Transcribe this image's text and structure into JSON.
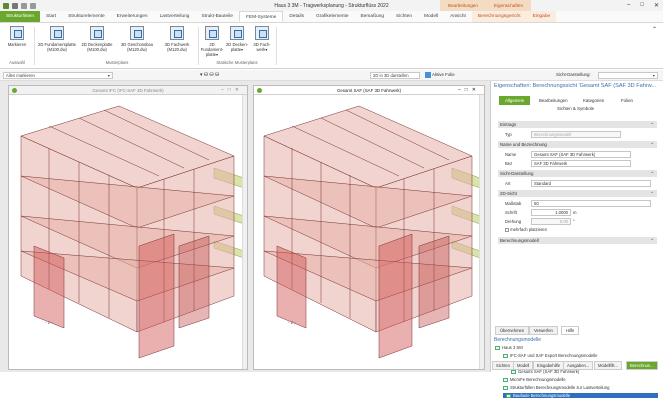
{
  "window": {
    "title": "Haus 3 3M - Tragwerksplanung - Strukturflüss 2022",
    "context_groups": [
      "Bearbeitungen",
      "Eigenschaften"
    ],
    "controls": [
      "–",
      "□",
      "✕"
    ]
  },
  "tabs": [
    "Strukturlisten",
    "Start",
    "Strukturelemente",
    "Erweiterungen",
    "Lastverteilung",
    "Strukt-Bauteile",
    "FEM-Systeme",
    "Details",
    "Grafikelemente",
    "Bemaßung",
    "Sichten",
    "Modell",
    "Ansicht",
    "Berechnungsgericht",
    "Eingabe"
  ],
  "ribbon": {
    "buttons": [
      {
        "label": "Markieren"
      },
      {
        "label": "2D Fundamentplatte (M100.dw)"
      },
      {
        "label": "2D Deckenplatte (M100.dw)"
      },
      {
        "label": "3D Geschossbau (M120.dw)"
      },
      {
        "label": "3D Fachwerk (M120.dw)"
      },
      {
        "label": "2D Fundament-platte▾"
      },
      {
        "label": "2D Decken-platte▾"
      },
      {
        "label": "3D Fach-werk▾"
      }
    ],
    "groups": [
      "Auswahl",
      "Musterplans",
      "Statische Musterplans"
    ]
  },
  "toolbar": {
    "filter_value": "Alles markieren",
    "view_button": "2D in 3D darstellen",
    "active_label": "Aktive Folie",
    "sicht_label": "Sicht-Darstellung:"
  },
  "viewports": [
    {
      "title": "Gesamt IFC (IFC-SAF 3D Fahrwerk)",
      "active": false,
      "axis_label": "- z -"
    },
    {
      "title": "Gesamt SAF (SAF 3D Fahrwerk)",
      "active": true,
      "axis_label": "- z -"
    }
  ],
  "panel": {
    "title": "Eigenschaften: Berechnungssicht 'Gesamt SAF (SAF 3D Fahrw...",
    "tabs": [
      "Allgemein",
      "Bearbeitungen",
      "Kategorien",
      "Folien"
    ],
    "subtab": "Sichten & Symbole",
    "sections": {
      "eintrag": "Eintrags",
      "typ_label": "Typ",
      "typ_value": "Berechnungsmodell",
      "name_section": "Name und Bezeichnung",
      "name_label": "Name",
      "name_value": "Gesamt SAF (SAF 3D Fahrwerk)",
      "bez_label": "Bez",
      "bez_value": "SAF 3D Fahrwerk",
      "darst_section": "Sicht-Darstellung",
      "art_label": "Art",
      "art_value": "Standard",
      "sicht_section": "2D-Sicht",
      "mass_label": "Maßstab",
      "mass_value": "50",
      "schrift_label": "Schrift",
      "schrift_value": "1.0000",
      "schrift_unit": "m",
      "drehung_label": "Drehung",
      "drehung_value": "0.00",
      "drehung_unit": "°",
      "check_label": "mehrfach platzieren",
      "berech_section": "Berechnungsmodell"
    },
    "bottom_tabs": [
      "Übernehmen",
      "Verwerfen",
      "Hilfe"
    ],
    "tree_title": "Berechnungsmodelle",
    "tree": [
      {
        "label": "Haus 3 SM",
        "level": 0
      },
      {
        "label": "IFC-SAF und SAF Export Berechnungsmodelle",
        "level": 1
      },
      {
        "label": "Gesamt IFC (IFC-SAF 3D Fahrwerk)",
        "level": 2
      },
      {
        "label": "Gesamt SAF (SAF 3D Fahrwerk)",
        "level": 2
      },
      {
        "label": "MicroFe Berechnungsmodelle",
        "level": 1
      },
      {
        "label": "Strukturfüllen Berechnungsmodelle zur Lastverteilung",
        "level": 1
      },
      {
        "label": "Baufaule Berechnungsmodelle",
        "level": 1,
        "selected": true
      }
    ],
    "footer_tabs": [
      "Sichten",
      "Modell",
      "Eingabehilfe",
      "Ausgaben...",
      "Modellfilt...",
      "Berechnun..."
    ]
  },
  "colors": {
    "accent": "#6aa82d",
    "context": "#c05020",
    "select": "#2f6fc0",
    "wall": "#d9a8a0",
    "slab": "#b8d070"
  }
}
